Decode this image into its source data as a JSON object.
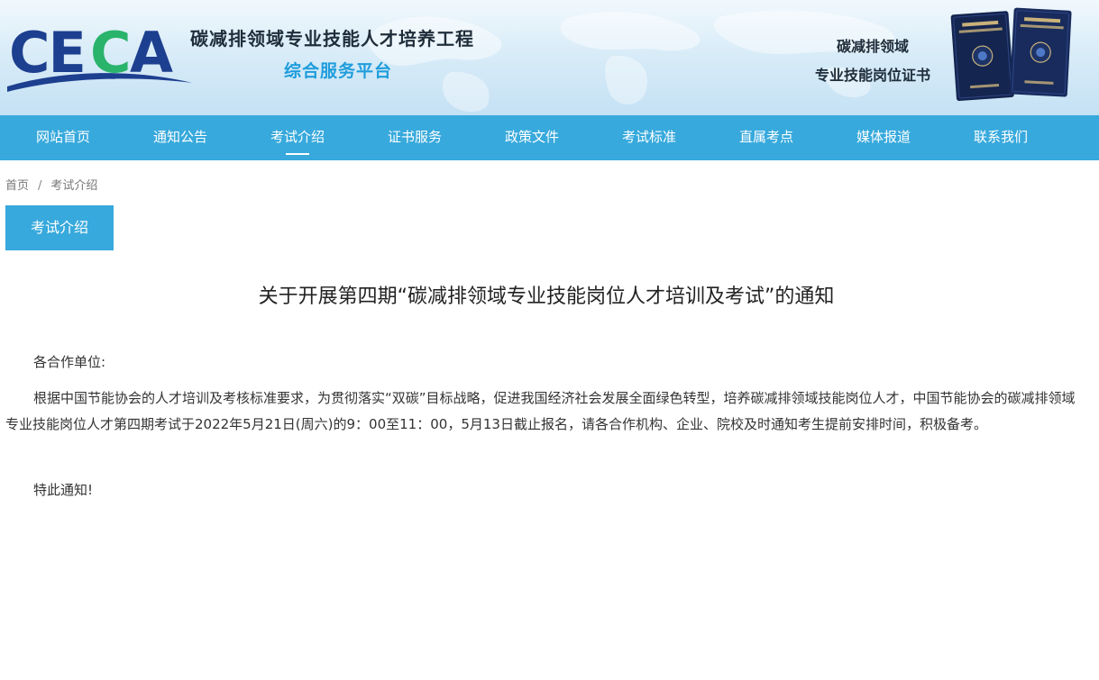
{
  "header": {
    "logo_text": "CECA",
    "title": "碳减排领域专业技能人才培养工程",
    "subtitle": "综合服务平台",
    "cert_line1": "碳减排领域",
    "cert_line2": "专业技能岗位证书",
    "colors": {
      "brand_blue": "#1f9ddc",
      "logo_navy": "#1d3f8f",
      "logo_green": "#29b36b"
    }
  },
  "nav": {
    "items": [
      {
        "label": "网站首页"
      },
      {
        "label": "通知公告"
      },
      {
        "label": "考试介绍",
        "active": true
      },
      {
        "label": "证书服务"
      },
      {
        "label": "政策文件"
      },
      {
        "label": "考试标准"
      },
      {
        "label": "直属考点"
      },
      {
        "label": "媒体报道"
      },
      {
        "label": "联系我们"
      }
    ],
    "background": "#37a9dc"
  },
  "breadcrumb": {
    "home": "首页",
    "separator": "/",
    "current": "考试介绍"
  },
  "section_tab": {
    "label": "考试介绍"
  },
  "article": {
    "title": "关于开展第四期“碳减排领域专业技能岗位人才培训及考试”的通知",
    "salutation": "各合作单位:",
    "paragraph": "根据中国节能协会的人才培训及考核标准要求，为贯彻落实“双碳”目标战略，促进我国经济社会发展全面绿色转型，培养碳减排领域技能岗位人才，中国节能协会的碳减排领域专业技能岗位人才第四期考试于2022年5月21日(周六)的9：00至11：00，5月13日截止报名，请各合作机构、企业、院校及时通知考生提前安排时间，积极备考。",
    "closing": "特此通知!"
  }
}
